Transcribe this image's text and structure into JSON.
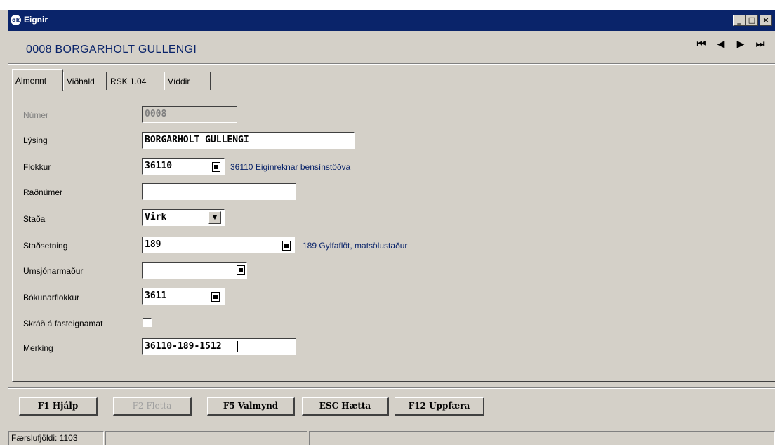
{
  "window": {
    "app_icon": "dk",
    "title": "Eignir",
    "buttons": {
      "minimize": "_",
      "maximize": "□",
      "close": "×"
    }
  },
  "record_title": "0008  BORGARHOLT GULLENGI",
  "nav": {
    "first": "⏮",
    "prev": "◀",
    "next": "▶",
    "last": "⏭"
  },
  "tabs": [
    {
      "label": "Almennt",
      "active": true
    },
    {
      "label": "Viðhald",
      "active": false
    },
    {
      "label": "RSK 1.04",
      "active": false
    },
    {
      "label": "Víddir",
      "active": false
    }
  ],
  "form": {
    "numer": {
      "label": "Númer",
      "value": "0008"
    },
    "lysing": {
      "label": "Lýsing",
      "value": "BORGARHOLT GULLENGI"
    },
    "flokkur": {
      "label": "Flokkur",
      "value": "36110",
      "description": "36110 Eiginreknar bensínstöðva"
    },
    "radnumer": {
      "label": "Raðnúmer",
      "value": ""
    },
    "stada": {
      "label": "Staða",
      "value": "Virk"
    },
    "stadsetning": {
      "label": "Staðsetning",
      "value": "189",
      "description": "189 Gylfaflöt, matsölustaður"
    },
    "umsjonarmadur": {
      "label": "Umsjónarmaður",
      "value": ""
    },
    "bokunarflokkur": {
      "label": "Bókunarflokkur",
      "value": "3611"
    },
    "skrad": {
      "label": "Skráð á fasteignamat",
      "checked": false
    },
    "merking": {
      "label": "Merking",
      "value": "36110-189-1512"
    }
  },
  "buttons": {
    "help": "F1  Hjálp",
    "browse": "F2  Fletta",
    "menu": "F5  Valmynd",
    "cancel": "ESC  Hætta",
    "update": "F12  Uppfæra"
  },
  "status": {
    "record_count": "Færslufjöldi: 1103"
  }
}
